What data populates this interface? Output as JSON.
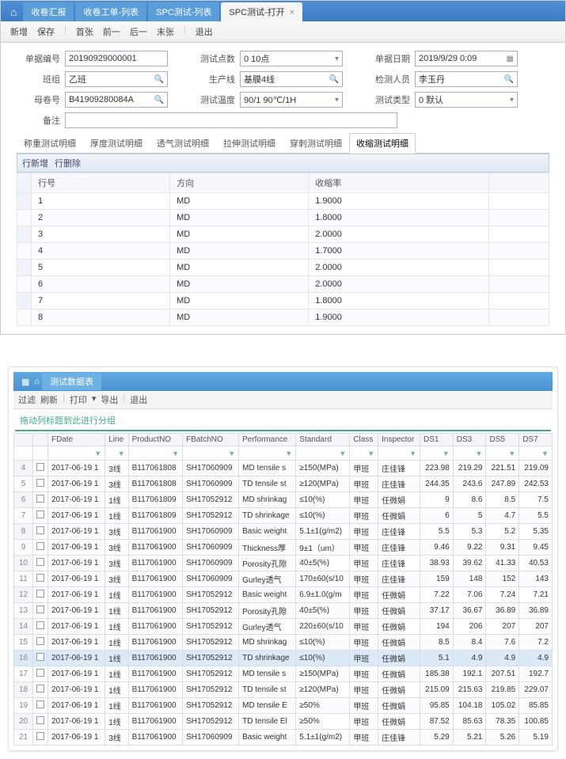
{
  "win1": {
    "tabs": [
      {
        "label": "收卷汇报"
      },
      {
        "label": "收卷工单-列表"
      },
      {
        "label": "SPC测试-列表"
      },
      {
        "label": "SPC测试-打开",
        "active": true
      }
    ],
    "toolbar": [
      "新增",
      "保存",
      "|",
      "首张",
      "前一",
      "后一",
      "末张",
      "|",
      "退出"
    ],
    "form": {
      "f1_lbl": "单据编号",
      "f1_val": "20190929000001",
      "f2_lbl": "测试点数",
      "f2_val": "0 10点",
      "f3_lbl": "单据日期",
      "f3_val": "2019/9/29 0:09",
      "f4_lbl": "班组",
      "f4_val": "乙班",
      "f5_lbl": "生产线",
      "f5_val": "基膜4线",
      "f6_lbl": "检测人员",
      "f6_val": "李玉丹",
      "f7_lbl": "母卷号",
      "f7_val": "B41909280084A",
      "f8_lbl": "测试温度",
      "f8_val": "90/1 90℃/1H",
      "f9_lbl": "测试类型",
      "f9_val": "0 默认",
      "f10_lbl": "备注",
      "f10_val": ""
    },
    "subtabs": [
      "称重测试明细",
      "厚度测试明细",
      "透气测试明细",
      "拉伸测试明细",
      "穿刺测试明细",
      "收缩测试明细"
    ],
    "subtab_active": 5,
    "rowbar": [
      "行新增",
      "行删除"
    ],
    "cols": [
      "行号",
      "方向",
      "收缩率"
    ],
    "rows": [
      {
        "n": "1",
        "dir": "MD",
        "val": "1.9000"
      },
      {
        "n": "2",
        "dir": "MD",
        "val": "1.8000"
      },
      {
        "n": "3",
        "dir": "MD",
        "val": "2.0000"
      },
      {
        "n": "4",
        "dir": "MD",
        "val": "1.7000"
      },
      {
        "n": "5",
        "dir": "MD",
        "val": "2.0000"
      },
      {
        "n": "6",
        "dir": "MD",
        "val": "2.0000"
      },
      {
        "n": "7",
        "dir": "MD",
        "val": "1.8000"
      },
      {
        "n": "8",
        "dir": "MD",
        "val": "1.9000"
      }
    ]
  },
  "win2": {
    "tab": "测试数据表",
    "toolbar": [
      "过滤",
      "刷新",
      "|",
      "打印",
      "▾",
      "导出",
      "|",
      "退出"
    ],
    "grouphint": "拖动列标题到此进行分组",
    "cols": [
      "",
      "FDate",
      "Line",
      "ProductNO",
      "FBatchNO",
      "Performance",
      "Standard",
      "Class",
      "Inspector",
      "DS1",
      "DS3",
      "DS5",
      "DS7"
    ],
    "rows": [
      {
        "rn": "4",
        "d": "2017-06-19 1",
        "ln": "3线",
        "p": "B117061808",
        "b": "SH17060909",
        "pf": "MD tensile s",
        "st": "≥150(MPa)",
        "cl": "甲班",
        "ins": "庄佳锋",
        "d1": "223.98",
        "d3": "219.29",
        "d5": "221.51",
        "d7": "219.09"
      },
      {
        "rn": "5",
        "d": "2017-06-19 1",
        "ln": "3线",
        "p": "B117061808",
        "b": "SH17060909",
        "pf": "TD tensile st",
        "st": "≥120(MPa)",
        "cl": "甲班",
        "ins": "庄佳锋",
        "d1": "244.35",
        "d3": "243.6",
        "d5": "247.89",
        "d7": "242.53"
      },
      {
        "rn": "6",
        "d": "2017-06-19 1",
        "ln": "1线",
        "p": "B117061809",
        "b": "SH17052912",
        "pf": "MD shrinkag",
        "st": "≤10(%)",
        "cl": "甲班",
        "ins": "任微娟",
        "d1": "9",
        "d3": "8.6",
        "d5": "8.5",
        "d7": "7.5"
      },
      {
        "rn": "7",
        "d": "2017-06-19 1",
        "ln": "1线",
        "p": "B117061809",
        "b": "SH17052912",
        "pf": "TD shrinkage",
        "st": "≤10(%)",
        "cl": "甲班",
        "ins": "任微娟",
        "d1": "6",
        "d3": "5",
        "d5": "4.7",
        "d7": "5.5"
      },
      {
        "rn": "8",
        "d": "2017-06-19 1",
        "ln": "3线",
        "p": "B117061900",
        "b": "SH17060909",
        "pf": "Basic weight",
        "st": "5.1±1(g/m2)",
        "cl": "甲班",
        "ins": "庄佳锋",
        "d1": "5.5",
        "d3": "5.3",
        "d5": "5.2",
        "d7": "5.35"
      },
      {
        "rn": "9",
        "d": "2017-06-19 1",
        "ln": "3线",
        "p": "B117061900",
        "b": "SH17060909",
        "pf": "Thickness厚",
        "st": "9±1（um）",
        "cl": "甲班",
        "ins": "庄佳锋",
        "d1": "9.46",
        "d3": "9.22",
        "d5": "9.31",
        "d7": "9.45"
      },
      {
        "rn": "10",
        "d": "2017-06-19 1",
        "ln": "3线",
        "p": "B117061900",
        "b": "SH17060909",
        "pf": "Porosity孔隙",
        "st": "40±5(%)",
        "cl": "甲班",
        "ins": "庄佳锋",
        "d1": "38.93",
        "d3": "39.62",
        "d5": "41.33",
        "d7": "40.53"
      },
      {
        "rn": "11",
        "d": "2017-06-19 1",
        "ln": "3线",
        "p": "B117061900",
        "b": "SH17060909",
        "pf": "Gurley透气",
        "st": "170±60(s/10",
        "cl": "甲班",
        "ins": "庄佳锋",
        "d1": "159",
        "d3": "148",
        "d5": "152",
        "d7": "143"
      },
      {
        "rn": "12",
        "d": "2017-06-19 1",
        "ln": "1线",
        "p": "B117061900",
        "b": "SH17052912",
        "pf": "Basic weight",
        "st": "6.9±1.0(g/m",
        "cl": "甲班",
        "ins": "任微娟",
        "d1": "7.22",
        "d3": "7.06",
        "d5": "7.24",
        "d7": "7.21"
      },
      {
        "rn": "13",
        "d": "2017-06-19 1",
        "ln": "1线",
        "p": "B117061900",
        "b": "SH17052912",
        "pf": "Porosity孔隙",
        "st": "40±5(%)",
        "cl": "甲班",
        "ins": "任微娟",
        "d1": "37.17",
        "d3": "36.67",
        "d5": "36.89",
        "d7": "36.89"
      },
      {
        "rn": "14",
        "d": "2017-06-19 1",
        "ln": "1线",
        "p": "B117061900",
        "b": "SH17052912",
        "pf": "Gurley透气",
        "st": "220±60(s/10",
        "cl": "甲班",
        "ins": "任微娟",
        "d1": "194",
        "d3": "206",
        "d5": "207",
        "d7": "207"
      },
      {
        "rn": "15",
        "d": "2017-06-19 1",
        "ln": "1线",
        "p": "B117061900",
        "b": "SH17052912",
        "pf": "MD shrinkag",
        "st": "≤10(%)",
        "cl": "甲班",
        "ins": "任微娟",
        "d1": "8.5",
        "d3": "8.4",
        "d5": "7.6",
        "d7": "7.2"
      },
      {
        "rn": "16",
        "d": "2017-06-19 1",
        "ln": "1线",
        "p": "B117061900",
        "b": "SH17052912",
        "pf": "TD shrinkage",
        "st": "≤10(%)",
        "cl": "甲班",
        "ins": "任微娟",
        "d1": "5.1",
        "d3": "4.9",
        "d5": "4.9",
        "d7": "4.9",
        "sel": true
      },
      {
        "rn": "17",
        "d": "2017-06-19 1",
        "ln": "1线",
        "p": "B117061900",
        "b": "SH17052912",
        "pf": "MD tensile s",
        "st": "≥150(MPa)",
        "cl": "甲班",
        "ins": "任微娟",
        "d1": "185.38",
        "d3": "192.1",
        "d5": "207.51",
        "d7": "192.7"
      },
      {
        "rn": "18",
        "d": "2017-06-19 1",
        "ln": "1线",
        "p": "B117061900",
        "b": "SH17052912",
        "pf": "TD tensile st",
        "st": "≥120(MPa)",
        "cl": "甲班",
        "ins": "任微娟",
        "d1": "215.09",
        "d3": "215.63",
        "d5": "219.85",
        "d7": "229.07"
      },
      {
        "rn": "19",
        "d": "2017-06-19 1",
        "ln": "1线",
        "p": "B117061900",
        "b": "SH17052912",
        "pf": "MD tensile E",
        "st": "≥50%",
        "cl": "甲班",
        "ins": "任微娟",
        "d1": "95.85",
        "d3": "104.18",
        "d5": "105.02",
        "d7": "85.85"
      },
      {
        "rn": "20",
        "d": "2017-06-19 1",
        "ln": "1线",
        "p": "B117061900",
        "b": "SH17052912",
        "pf": "TD tensile El",
        "st": "≥50%",
        "cl": "甲班",
        "ins": "任微娟",
        "d1": "87.52",
        "d3": "85.63",
        "d5": "78.35",
        "d7": "100.85"
      },
      {
        "rn": "21",
        "d": "2017-06-19 1",
        "ln": "3线",
        "p": "B117061900",
        "b": "SH17060909",
        "pf": "Basic weight",
        "st": "5.1±1(g/m2)",
        "cl": "甲班",
        "ins": "庄佳锋",
        "d1": "5.29",
        "d3": "5.21",
        "d5": "5.26",
        "d7": "5.19"
      }
    ]
  }
}
